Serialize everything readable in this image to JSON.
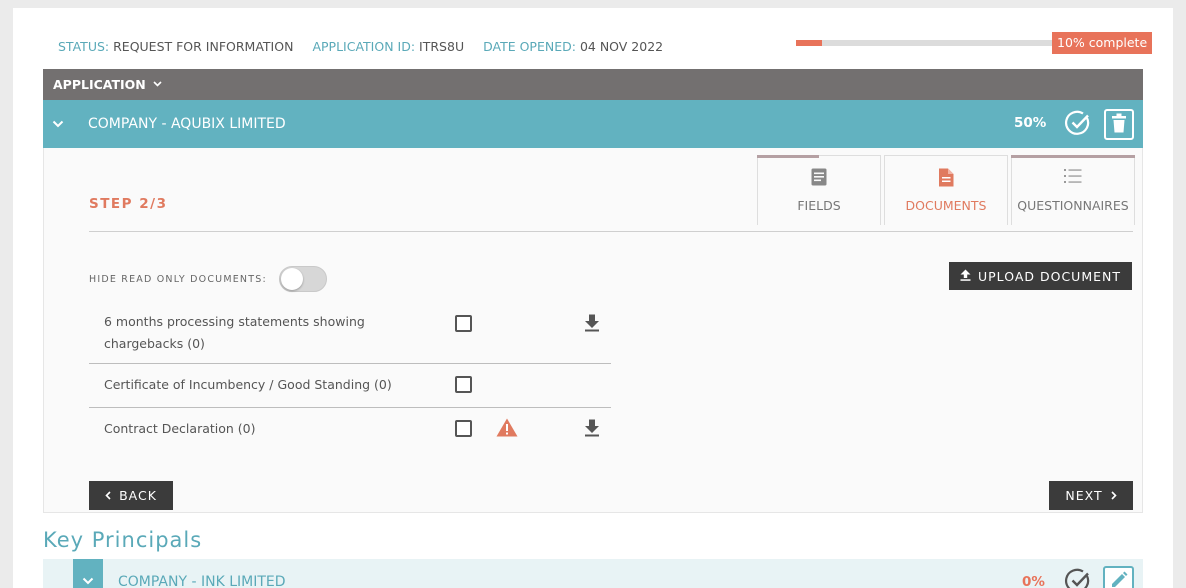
{
  "status": {
    "status_label": "STATUS:",
    "status_value": "REQUEST FOR INFORMATION",
    "app_id_label": "APPLICATION ID:",
    "app_id_value": "ITRS8U",
    "date_label": "DATE OPENED:",
    "date_value": "04 NOV 2022",
    "progress_fraction": 0.1,
    "progress_text": "10% complete"
  },
  "application_bar": {
    "label": "APPLICATION",
    "chevron_icon": "chevron-down-icon"
  },
  "company": {
    "collapse_icon": "chevron-down-icon",
    "name": "COMPANY - AQUBIX LIMITED",
    "percent": "50%",
    "check_icon": "check-circle-icon",
    "delete_icon": "trash-icon"
  },
  "step": {
    "label": "STEP 2/3",
    "tabs": [
      {
        "label": "FIELDS",
        "icon": "form-icon",
        "active": false
      },
      {
        "label": "DOCUMENTS",
        "icon": "document-icon",
        "active": true
      },
      {
        "label": "QUESTIONNAIRES",
        "icon": "list-icon",
        "active": false
      }
    ],
    "hide_readonly_label": "HIDE READ ONLY DOCUMENTS:",
    "hide_readonly_on": false,
    "upload_label": "UPLOAD DOCUMENT",
    "documents": [
      {
        "name": "6 months processing statements showing chargebacks (0)",
        "checked": false,
        "warning": false,
        "download": true
      },
      {
        "name": "Certificate of Incumbency / Good Standing (0)",
        "checked": false,
        "warning": false,
        "download": false
      },
      {
        "name": "Contract Declaration (0)",
        "checked": false,
        "warning": true,
        "download": true
      }
    ],
    "back_label": "BACK",
    "next_label": "NEXT"
  },
  "key_principals": {
    "title": "Key Principals",
    "row": {
      "name": "COMPANY - INK LIMITED",
      "percent": "0%",
      "check_icon": "check-circle-icon",
      "edit_icon": "pencil-icon"
    }
  },
  "colors": {
    "accent_teal": "#62b2c0",
    "accent_orange": "#e8735a",
    "dark": "#3b3b3b",
    "bar_gray": "#737070"
  }
}
